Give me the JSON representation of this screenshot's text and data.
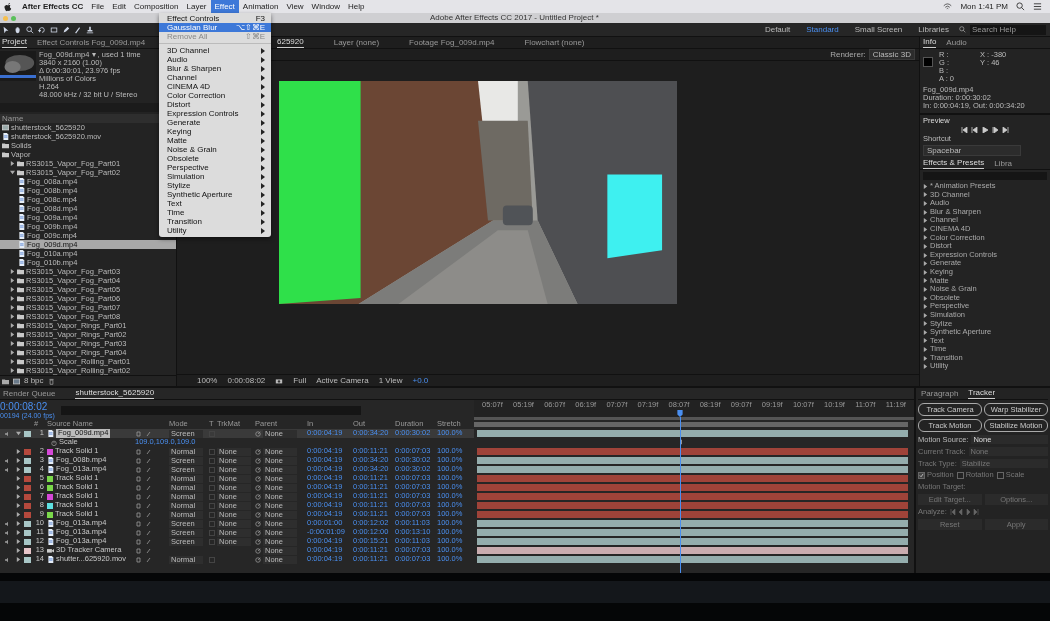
{
  "menubar": {
    "app": "After Effects CC",
    "items": [
      {
        "label": "File",
        "selected": false
      },
      {
        "label": "Edit",
        "selected": false
      },
      {
        "label": "Composition",
        "selected": false
      },
      {
        "label": "Layer",
        "selected": false
      },
      {
        "label": "Effect",
        "selected": true
      },
      {
        "label": "Animation",
        "selected": false
      },
      {
        "label": "View",
        "selected": false
      },
      {
        "label": "Window",
        "selected": false
      },
      {
        "label": "Help",
        "selected": false
      }
    ],
    "clock": "Mon 1:41 PM"
  },
  "window": {
    "title": "Adobe After Effects CC 2017 - Untitled Project *"
  },
  "workspaces": [
    {
      "label": "Default",
      "selected": false
    },
    {
      "label": "Standard",
      "selected": true
    },
    {
      "label": "Small Screen",
      "selected": false
    },
    {
      "label": "Libraries",
      "selected": false
    }
  ],
  "search": {
    "placeholder": "Search Help"
  },
  "effect_menu": {
    "items": [
      {
        "label": "Effect Controls",
        "shortcut": "F3",
        "kind": "command",
        "highlighted": false,
        "disabled": false
      },
      {
        "label": "Gaussian Blur",
        "shortcut": "⌥⇧⌘E",
        "kind": "command",
        "highlighted": true,
        "disabled": false
      },
      {
        "label": "Remove All",
        "shortcut": "⇧⌘E",
        "kind": "command",
        "highlighted": false,
        "disabled": true
      },
      {
        "kind": "separator"
      },
      {
        "label": "3D Channel",
        "kind": "submenu"
      },
      {
        "label": "Audio",
        "kind": "submenu"
      },
      {
        "label": "Blur & Sharpen",
        "kind": "submenu"
      },
      {
        "label": "Channel",
        "kind": "submenu"
      },
      {
        "label": "CINEMA 4D",
        "kind": "submenu"
      },
      {
        "label": "Color Correction",
        "kind": "submenu"
      },
      {
        "label": "Distort",
        "kind": "submenu"
      },
      {
        "label": "Expression Controls",
        "kind": "submenu"
      },
      {
        "label": "Generate",
        "kind": "submenu"
      },
      {
        "label": "Keying",
        "kind": "submenu"
      },
      {
        "label": "Matte",
        "kind": "submenu"
      },
      {
        "label": "Noise & Grain",
        "kind": "submenu"
      },
      {
        "label": "Obsolete",
        "kind": "submenu"
      },
      {
        "label": "Perspective",
        "kind": "submenu"
      },
      {
        "label": "Simulation",
        "kind": "submenu"
      },
      {
        "label": "Stylize",
        "kind": "submenu"
      },
      {
        "label": "Synthetic Aperture",
        "kind": "submenu"
      },
      {
        "label": "Text",
        "kind": "submenu"
      },
      {
        "label": "Time",
        "kind": "submenu"
      },
      {
        "label": "Transition",
        "kind": "submenu"
      },
      {
        "label": "Utility",
        "kind": "submenu"
      }
    ]
  },
  "project": {
    "tabs": [
      {
        "label": "Project",
        "selected": true
      },
      {
        "label": "Effect Controls Fog_009d.mp4",
        "selected": false
      }
    ],
    "info": [
      "Fog_009d.mp4 ▾ , used 1 time",
      "3840 x 2160 (1.00)",
      "Δ 0:00:30:01, 23.976 fps",
      "Millions of Colors",
      "H.264",
      "48.000 kHz / 32 bit U / Stereo"
    ],
    "column": "Name",
    "bit_depth": "8 bpc",
    "items": [
      {
        "name": "shutterstock_5625920",
        "kind": "comp",
        "selected": false
      },
      {
        "name": "shutterstock_5625920.mov",
        "kind": "footage",
        "selected": false
      },
      {
        "name": "Solids",
        "kind": "folder",
        "selected": false
      },
      {
        "name": "Vapor",
        "kind": "folder",
        "selected": false,
        "children": [
          {
            "name": "RS3015_Vapor_Fog_Part01",
            "kind": "folder",
            "expanded": false,
            "selected": false
          },
          {
            "name": "RS3015_Vapor_Fog_Part02",
            "kind": "folder",
            "expanded": true,
            "selected": false,
            "children": [
              {
                "name": "Fog_008a.mp4",
                "kind": "footage",
                "selected": false
              },
              {
                "name": "Fog_008b.mp4",
                "kind": "footage",
                "selected": false
              },
              {
                "name": "Fog_008c.mp4",
                "kind": "footage",
                "selected": false
              },
              {
                "name": "Fog_008d.mp4",
                "kind": "footage",
                "selected": false
              },
              {
                "name": "Fog_009a.mp4",
                "kind": "footage",
                "selected": false
              },
              {
                "name": "Fog_009b.mp4",
                "kind": "footage",
                "selected": false
              },
              {
                "name": "Fog_009c.mp4",
                "kind": "footage",
                "selected": false
              },
              {
                "name": "Fog_009d.mp4",
                "kind": "footage",
                "selected": true
              },
              {
                "name": "Fog_010a.mp4",
                "kind": "footage",
                "selected": false
              },
              {
                "name": "Fog_010b.mp4",
                "kind": "footage",
                "selected": false
              }
            ]
          },
          {
            "name": "RS3015_Vapor_Fog_Part03",
            "kind": "folder",
            "expanded": false,
            "selected": false
          },
          {
            "name": "RS3015_Vapor_Fog_Part04",
            "kind": "folder",
            "expanded": false,
            "selected": false
          },
          {
            "name": "RS3015_Vapor_Fog_Part05",
            "kind": "folder",
            "expanded": false,
            "selected": false
          },
          {
            "name": "RS3015_Vapor_Fog_Part06",
            "kind": "folder",
            "expanded": false,
            "selected": false
          },
          {
            "name": "RS3015_Vapor_Fog_Part07",
            "kind": "folder",
            "expanded": false,
            "selected": false
          },
          {
            "name": "RS3015_Vapor_Fog_Part08",
            "kind": "folder",
            "expanded": false,
            "selected": false
          },
          {
            "name": "RS3015_Vapor_Rings_Part01",
            "kind": "folder",
            "expanded": false,
            "selected": false
          },
          {
            "name": "RS3015_Vapor_Rings_Part02",
            "kind": "folder",
            "expanded": false,
            "selected": false
          },
          {
            "name": "RS3015_Vapor_Rings_Part03",
            "kind": "folder",
            "expanded": false,
            "selected": false
          },
          {
            "name": "RS3015_Vapor_Rings_Part04",
            "kind": "folder",
            "expanded": false,
            "selected": false
          },
          {
            "name": "RS3015_Vapor_Rolling_Part01",
            "kind": "folder",
            "expanded": false,
            "selected": false
          },
          {
            "name": "RS3015_Vapor_Rolling_Part02",
            "kind": "folder",
            "expanded": false,
            "selected": false
          }
        ]
      }
    ]
  },
  "viewer": {
    "tabs": [
      {
        "label": "625920",
        "selected": true
      },
      {
        "label": "Layer (none)",
        "selected": false
      },
      {
        "label": "Footage Fog_009d.mp4",
        "selected": false
      },
      {
        "label": "Flowchart (none)",
        "selected": false
      }
    ],
    "renderer_label": "Renderer:",
    "renderer": "Classic 3D",
    "toolbar": {
      "zoom": "100%",
      "time": "0:00:08:02",
      "resolution": "Full",
      "view": "Active Camera",
      "layout": "1 View",
      "exposure": "+0.0"
    }
  },
  "info": {
    "tabs": [
      {
        "label": "Info",
        "selected": true
      },
      {
        "label": "Audio",
        "selected": false
      }
    ],
    "channels": [
      "R :",
      "G :",
      "B :",
      "A : 0"
    ],
    "coords": [
      "X : -380",
      "Y : 46"
    ],
    "lines": [
      "Fog_009d.mp4",
      "Duration: 0:00:30:02",
      "In: 0:00:04:19, Out: 0:00:34:20"
    ]
  },
  "preview": {
    "title": "Preview",
    "shortcut_label": "Shortcut",
    "shortcut": "Spacebar"
  },
  "effects": {
    "tabs": [
      {
        "label": "Effects & Presets",
        "selected": true
      },
      {
        "label": "Libra",
        "selected": false
      }
    ],
    "items": [
      "* Animation Presets",
      "3D Channel",
      "Audio",
      "Blur & Sharpen",
      "Channel",
      "CINEMA 4D",
      "Color Correction",
      "Distort",
      "Expression Controls",
      "Generate",
      "Keying",
      "Matte",
      "Noise & Grain",
      "Obsolete",
      "Perspective",
      "Simulation",
      "Stylize",
      "Synthetic Aperture",
      "Text",
      "Time",
      "Transition",
      "Utility"
    ]
  },
  "timeline": {
    "tabs": [
      {
        "label": "Render Queue",
        "selected": false
      },
      {
        "label": "shutterstock_5625920",
        "selected": true
      }
    ],
    "time": "0:00:08:02",
    "frames": "00194 (24.00 fps)",
    "columns": {
      "number": "#",
      "source": "Source Name",
      "mode": "Mode",
      "t": "T",
      "trkmat": "TrkMat",
      "parent": "Parent",
      "in": "In",
      "out": "Out",
      "duration": "Duration",
      "stretch": "Stretch"
    },
    "ruler": [
      "05:07f",
      "05:19f",
      "06:07f",
      "06:19f",
      "07:07f",
      "07:19f",
      "08:07f",
      "08:19f",
      "09:07f",
      "09:19f",
      "10:07f",
      "10:19f",
      "11:07f",
      "11:19f"
    ],
    "playhead": {
      "level": 0.468
    },
    "layers": [
      {
        "number": "1",
        "name": "Fog_009d.mp4",
        "kind": "footage",
        "color": "#a8c6c6",
        "selected": true,
        "expanded": true,
        "mode": "Screen",
        "parent": "None",
        "in": "0:00:04:19",
        "out": "0:00:34:20",
        "duration": "0:00:30:02",
        "stretch": "100.0%",
        "property": {
          "name": "Scale",
          "value": "109.0,109.0,109.0"
        }
      },
      {
        "number": "2",
        "name": "Track Solid 1",
        "kind": "solid",
        "color": "#b5493d",
        "swatch": {
          "color": "#d648d8"
        },
        "selected": false,
        "expanded": false,
        "mode": "Normal",
        "trkmat": "None",
        "parent": "None",
        "in": "0:00:04:19",
        "out": "0:00:11:21",
        "duration": "0:00:07:03",
        "stretch": "100.0%"
      },
      {
        "number": "3",
        "name": "Fog_008b.mp4",
        "kind": "footage",
        "color": "#a8c6c6",
        "selected": false,
        "expanded": false,
        "mode": "Screen",
        "trkmat": "None",
        "parent": "None",
        "in": "0:00:04:19",
        "out": "0:00:34:20",
        "duration": "0:00:30:02",
        "stretch": "100.0%"
      },
      {
        "number": "4",
        "name": "Fog_013a.mp4",
        "kind": "footage",
        "color": "#a8c6c6",
        "selected": false,
        "expanded": false,
        "mode": "Screen",
        "trkmat": "None",
        "parent": "None",
        "in": "0:00:04:19",
        "out": "0:00:34:20",
        "duration": "0:00:30:02",
        "stretch": "100.0%"
      },
      {
        "number": "5",
        "name": "Track Solid 1",
        "kind": "solid",
        "color": "#b5493d",
        "swatch": {
          "color": "#7ad84a"
        },
        "selected": false,
        "expanded": false,
        "mode": "Normal",
        "trkmat": "None",
        "parent": "None",
        "in": "0:00:04:19",
        "out": "0:00:11:21",
        "duration": "0:00:07:03",
        "stretch": "100.0%"
      },
      {
        "number": "6",
        "name": "Track Solid 1",
        "kind": "solid",
        "color": "#b5493d",
        "swatch": {
          "color": "#7ad84a"
        },
        "selected": false,
        "expanded": false,
        "mode": "Normal",
        "trkmat": "None",
        "parent": "None",
        "in": "0:00:04:19",
        "out": "0:00:11:21",
        "duration": "0:00:07:03",
        "stretch": "100.0%"
      },
      {
        "number": "7",
        "name": "Track Solid 1",
        "kind": "solid",
        "color": "#b5493d",
        "swatch": {
          "color": "#d648d8"
        },
        "selected": false,
        "expanded": false,
        "mode": "Normal",
        "trkmat": "None",
        "parent": "None",
        "in": "0:00:04:19",
        "out": "0:00:11:21",
        "duration": "0:00:07:03",
        "stretch": "100.0%"
      },
      {
        "number": "8",
        "name": "Track Solid 1",
        "kind": "solid",
        "color": "#b5493d",
        "swatch": {
          "color": "#5ee0e0"
        },
        "selected": false,
        "expanded": false,
        "mode": "Normal",
        "trkmat": "None",
        "parent": "None",
        "in": "0:00:04:19",
        "out": "0:00:11:21",
        "duration": "0:00:07:03",
        "stretch": "100.0%"
      },
      {
        "number": "9",
        "name": "Track Solid 1",
        "kind": "solid",
        "color": "#b5493d",
        "swatch": {
          "color": "#7ad84a"
        },
        "selected": false,
        "expanded": false,
        "mode": "Normal",
        "trkmat": "None",
        "parent": "None",
        "in": "0:00:04:19",
        "out": "0:00:11:21",
        "duration": "0:00:07:03",
        "stretch": "100.0%"
      },
      {
        "number": "10",
        "name": "Fog_013a.mp4",
        "kind": "footage",
        "color": "#a8c6c6",
        "selected": false,
        "expanded": false,
        "mode": "Screen",
        "trkmat": "None",
        "parent": "None",
        "in": "0:00:01:00",
        "out": "0:00:12:02",
        "duration": "0:00:11:03",
        "stretch": "100.0%"
      },
      {
        "number": "11",
        "name": "Fog_013a.mp4",
        "kind": "footage",
        "color": "#a8c6c6",
        "selected": false,
        "expanded": false,
        "mode": "Screen",
        "trkmat": "None",
        "parent": "None",
        "in": "-0:00:01:09",
        "out": "0:00:12:00",
        "duration": "0:00:13:10",
        "stretch": "100.0%"
      },
      {
        "number": "12",
        "name": "Fog_013a.mp4",
        "kind": "footage",
        "color": "#a8c6c6",
        "selected": false,
        "expanded": false,
        "mode": "Screen",
        "trkmat": "None",
        "parent": "None",
        "in": "0:00:04:19",
        "out": "0:00:15:21",
        "duration": "0:00:11:03",
        "stretch": "100.0%"
      },
      {
        "number": "13",
        "name": "3D Tracker Camera",
        "kind": "camera",
        "color": "#e6c4c8",
        "selected": false,
        "expanded": false,
        "parent": "None",
        "in": "0:00:04:19",
        "out": "0:00:11:21",
        "duration": "0:00:07:03",
        "stretch": "100.0%"
      },
      {
        "number": "14",
        "name": "shutter...625920.mov",
        "kind": "footage",
        "color": "#a8c6c6",
        "selected": false,
        "expanded": false,
        "mode": "Normal",
        "parent": "None",
        "in": "0:00:04:19",
        "out": "0:00:11:21",
        "duration": "0:00:07:03",
        "stretch": "100.0%"
      }
    ]
  },
  "tracker": {
    "tabs": [
      {
        "label": "Paragraph",
        "selected": false
      },
      {
        "label": "Tracker",
        "selected": true
      }
    ],
    "buttons": [
      "Track Camera",
      "Warp Stabilizer",
      "Track Motion",
      "Stabilize Motion"
    ],
    "fields": [
      {
        "label": "Motion Source:",
        "value": "None",
        "disabled": false
      },
      {
        "label": "Current Track:",
        "value": "None",
        "disabled": true
      },
      {
        "label": "Track Type:",
        "value": "Stabilize",
        "disabled": true
      }
    ],
    "checks": [
      {
        "label": "Position",
        "checked": true
      },
      {
        "label": "Rotation",
        "checked": false
      },
      {
        "label": "Scale",
        "checked": false
      }
    ],
    "motion_target": "Motion Target:",
    "target_buttons": [
      {
        "label": "Edit Target...",
        "disabled": true
      },
      {
        "label": "Options...",
        "disabled": true
      }
    ],
    "analyze": "Analyze:",
    "bottom_buttons": [
      {
        "label": "Reset",
        "disabled": true
      },
      {
        "label": "Apply",
        "disabled": true
      }
    ]
  }
}
